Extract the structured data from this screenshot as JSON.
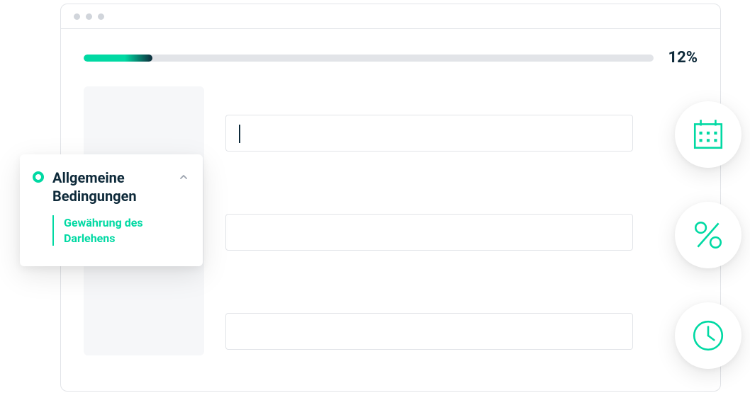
{
  "progress": {
    "percent": 12,
    "label": "12%"
  },
  "sidebar": {
    "title": "Allgemeine Bedingungen",
    "subitem": "Gewährung des Darlehens"
  },
  "icons": {
    "calendar": "calendar-icon",
    "percent": "percent-icon",
    "clock": "clock-icon"
  },
  "colors": {
    "accent": "#00d9a3",
    "text_dark": "#0e2a3a",
    "border": "#e2e4e8",
    "placeholder_bg": "#f6f7f9"
  }
}
